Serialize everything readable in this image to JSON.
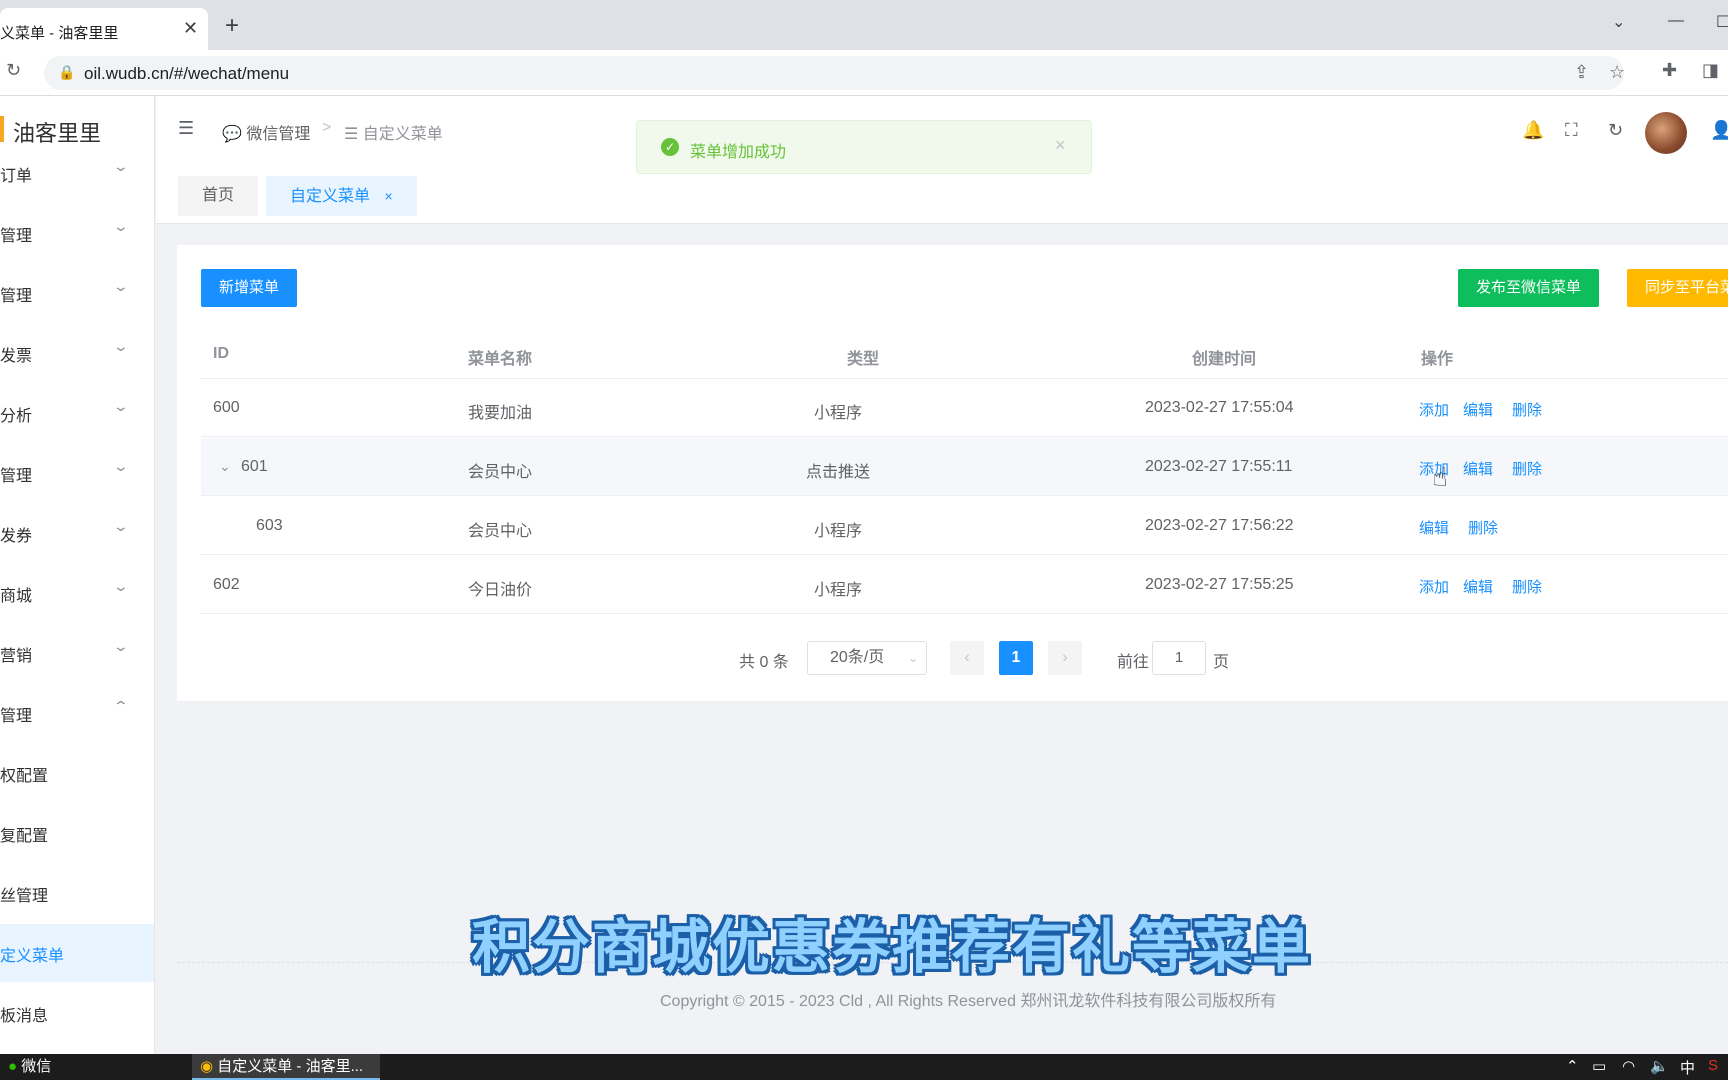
{
  "browser": {
    "tab_title": "义菜单 - 油客里里",
    "url": "oil.wudb.cn/#/wechat/menu"
  },
  "sidebar": {
    "logo": "油客里里",
    "items": [
      {
        "label": "订单",
        "arrow": "⌄"
      },
      {
        "label": "管理",
        "arrow": "⌄"
      },
      {
        "label": "管理",
        "arrow": "⌄"
      },
      {
        "label": "发票",
        "arrow": "⌄"
      },
      {
        "label": "分析",
        "arrow": "⌄"
      },
      {
        "label": "管理",
        "arrow": "⌄"
      },
      {
        "label": "发券",
        "arrow": "⌄"
      },
      {
        "label": "商城",
        "arrow": "⌄"
      },
      {
        "label": "营销",
        "arrow": "⌄"
      },
      {
        "label": "管理",
        "arrow": "⌃"
      },
      {
        "label": "权配置",
        "arrow": ""
      },
      {
        "label": "复配置",
        "arrow": ""
      },
      {
        "label": "丝管理",
        "arrow": ""
      },
      {
        "label": "定义菜单",
        "arrow": ""
      },
      {
        "label": "板消息",
        "arrow": ""
      }
    ]
  },
  "header": {
    "breadcrumb_parent": "微信管理",
    "breadcrumb_sep": ">",
    "breadcrumb_current": "自定义菜单"
  },
  "tags": {
    "home": "首页",
    "current": "自定义菜单",
    "close": "×"
  },
  "toast": {
    "text": "菜单增加成功",
    "close": "×"
  },
  "toolbar": {
    "add_label": "新增菜单",
    "publish_label": "发布至微信菜单",
    "sync_label": "同步至平台菜单"
  },
  "table": {
    "columns": [
      "ID",
      "菜单名称",
      "类型",
      "创建时间",
      "操作"
    ],
    "rows": [
      {
        "id": "600",
        "name": "我要加油",
        "type": "小程序",
        "created": "2023-02-27 17:55:04",
        "ops": [
          "添加",
          "编辑",
          "删除"
        ]
      },
      {
        "id": "601",
        "name": "会员中心",
        "type": "点击推送",
        "created": "2023-02-27 17:55:11",
        "ops": [
          "添加",
          "编辑",
          "删除"
        ]
      },
      {
        "id": "603",
        "name": "会员中心",
        "type": "小程序",
        "created": "2023-02-27 17:56:22",
        "ops": [
          "编辑",
          "删除"
        ]
      },
      {
        "id": "602",
        "name": "今日油价",
        "type": "小程序",
        "created": "2023-02-27 17:55:25",
        "ops": [
          "添加",
          "编辑",
          "删除"
        ]
      }
    ]
  },
  "pagination": {
    "total": "共 0 条",
    "page_size": "20条/页",
    "current_page": "1",
    "goto_label": "前往",
    "goto_value": "1",
    "page_suffix": "页"
  },
  "footer": {
    "copyright": "Copyright © 2015 - 2023 Cld , All Rights Reserved 郑州讯龙软件科技有限公司版权所有"
  },
  "subtitle": "积分商城优惠券推荐有礼等菜单",
  "taskbar": {
    "wechat": "微信",
    "chrome": "自定义菜单 - 油客里...",
    "ime": "中"
  },
  "colors": {
    "primary": "#1890ff",
    "success": "#0ebe5c",
    "warning": "#ffba00",
    "toast_bg": "#f0f9eb"
  }
}
